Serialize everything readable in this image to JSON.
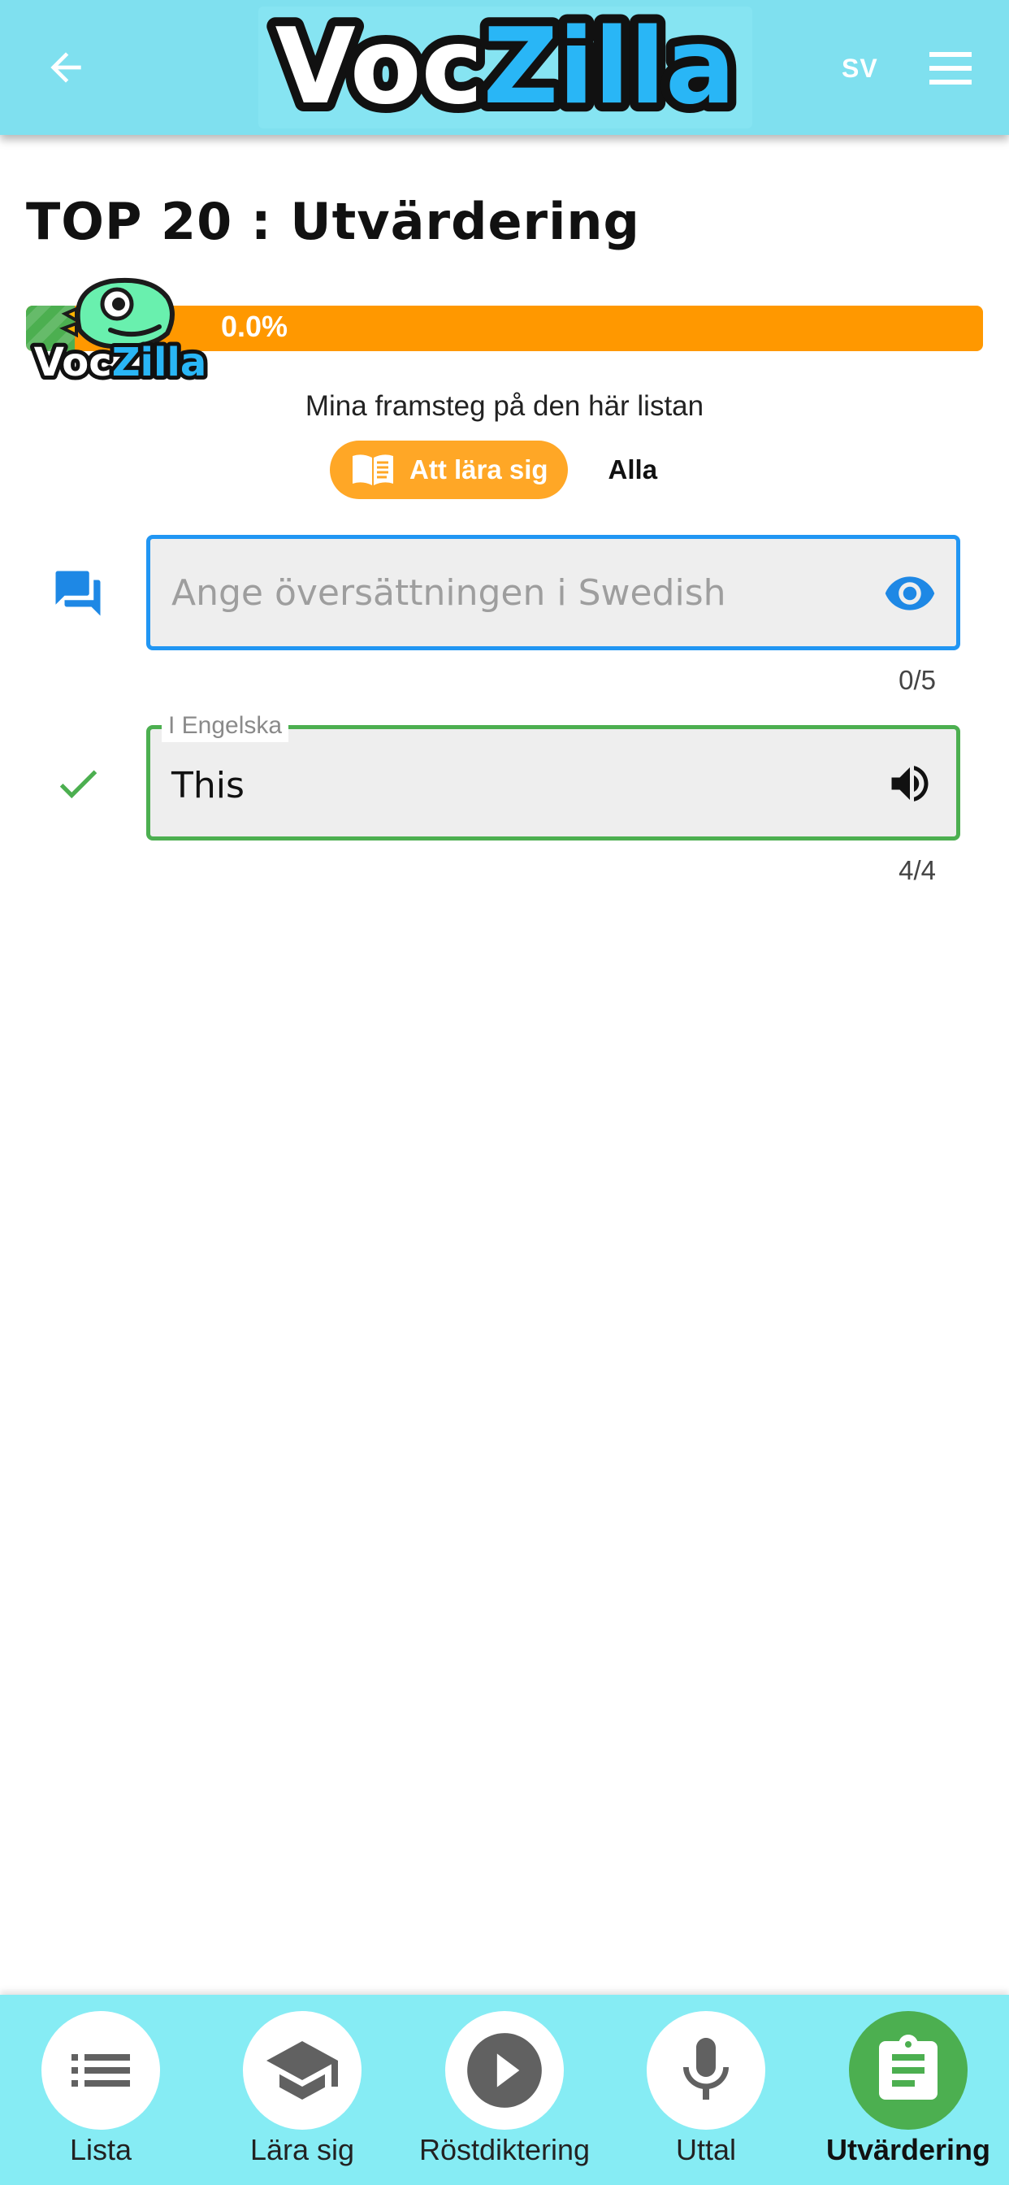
{
  "header": {
    "back_icon": "arrow-back-icon",
    "logo": {
      "part1": "Voc",
      "part2": "Zilla",
      "color1": "#ffffff",
      "color2": "#29b6f6"
    },
    "language": "SV",
    "menu_icon": "hamburger-menu-icon"
  },
  "page": {
    "title": "TOP 20 : Utvärdering"
  },
  "progress": {
    "value_text": "0.0%",
    "value": 0.0,
    "caption": "Mina framsteg på den här listan",
    "mascot_logo_part1": "Voc",
    "mascot_logo_part2": "Zilla",
    "track_color": "#ff9800",
    "fill_color": "#4caf50"
  },
  "filters": {
    "active_label": "Att lära sig",
    "active_icon": "open-book-icon",
    "other_label": "Alla"
  },
  "answer_field": {
    "placeholder": "Ange översättningen i Swedish",
    "value": "",
    "row_icon": "chat-bubbles-icon",
    "action_icon": "eye-icon",
    "counter": "0/5",
    "border_color": "#2196f3"
  },
  "source_field": {
    "label": "I Engelska",
    "value": "This",
    "row_icon": "check-icon",
    "action_icon": "speaker-icon",
    "counter": "4/4",
    "border_color": "#4caf50"
  },
  "bottom_nav": {
    "items": [
      {
        "label": "Lista",
        "icon": "list-icon",
        "active": false
      },
      {
        "label": "Lära sig",
        "icon": "graduation-cap-icon",
        "active": false
      },
      {
        "label": "Röstdiktering",
        "icon": "play-icon",
        "active": false
      },
      {
        "label": "Uttal",
        "icon": "microphone-icon",
        "active": false
      },
      {
        "label": "Utvärdering",
        "icon": "clipboard-icon",
        "active": true
      }
    ]
  }
}
